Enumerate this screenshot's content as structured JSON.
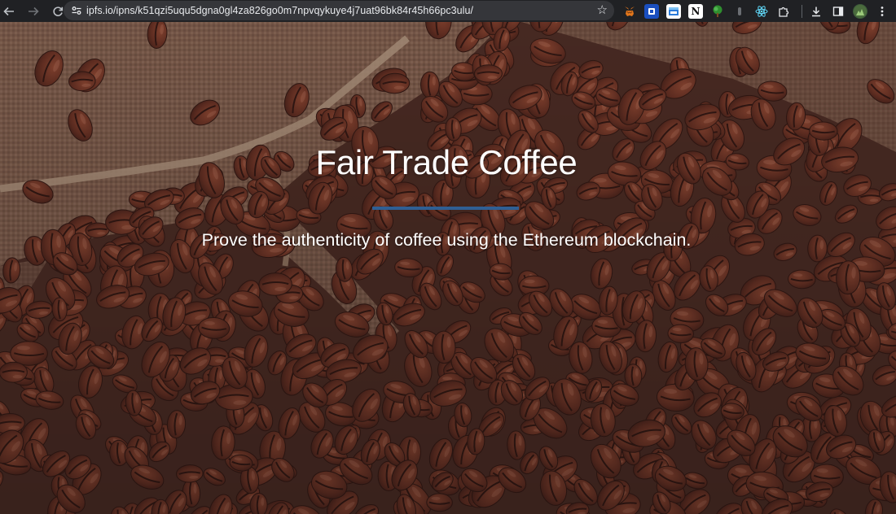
{
  "browser": {
    "url": "ipfs.io/ipns/k51qzi5uqu5dgna0gl4za826go0m7npvqykuye4j7uat96bk84r45h66pc3ulu/",
    "nav": {
      "back_icon": "arrow-left-icon",
      "forward_icon": "arrow-right-icon",
      "reload_icon": "reload-icon"
    },
    "extensions": [
      "metamask-icon",
      "shield-extension-icon",
      "window-extension-icon",
      "notion-icon",
      "tree-extension-icon",
      "dot-extension-icon",
      "react-icon",
      "puzzle-icon",
      "download-icon",
      "sidebar-icon",
      "profile-avatar",
      "kebab-menu-icon"
    ]
  },
  "hero": {
    "title": "Fair Trade Coffee",
    "subtitle": "Prove the authenticity of coffee using the Ethereum blockchain.",
    "divider_color": "#2f5f94"
  }
}
